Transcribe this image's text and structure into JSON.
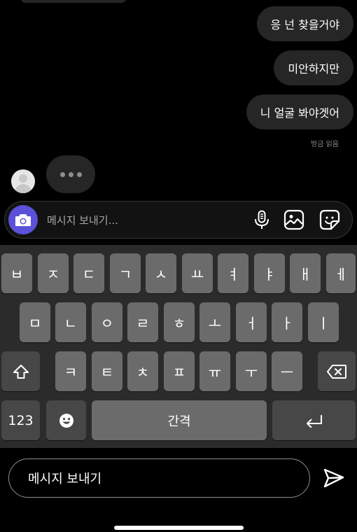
{
  "messages": {
    "sent": [
      "응 넌 찾을거야",
      "미안하지만",
      "니 얼굴 봐야겟어"
    ],
    "read_receipt": "방금 읽음"
  },
  "composer": {
    "placeholder": "메시지 보내기..."
  },
  "keyboard": {
    "row1": [
      "ㅂ",
      "ㅈ",
      "ㄷ",
      "ㄱ",
      "ㅅ",
      "ㅛ",
      "ㅕ",
      "ㅑ",
      "ㅐ",
      "ㅔ"
    ],
    "row2": [
      "ㅁ",
      "ㄴ",
      "ㅇ",
      "ㄹ",
      "ㅎ",
      "ㅗ",
      "ㅓ",
      "ㅏ",
      "ㅣ"
    ],
    "row3": [
      "ㅋ",
      "ㅌ",
      "ㅊ",
      "ㅍ",
      "ㅠ",
      "ㅜ",
      "ㅡ"
    ],
    "numbers_label": "123",
    "space_label": "간격"
  },
  "bottom_input": {
    "text": "메시지 보내기"
  },
  "colors": {
    "background": "#000000",
    "bubble": "#262626",
    "camera_accent": "#5b51d8",
    "key": "#6b6b6b",
    "key_dark": "#474747"
  }
}
